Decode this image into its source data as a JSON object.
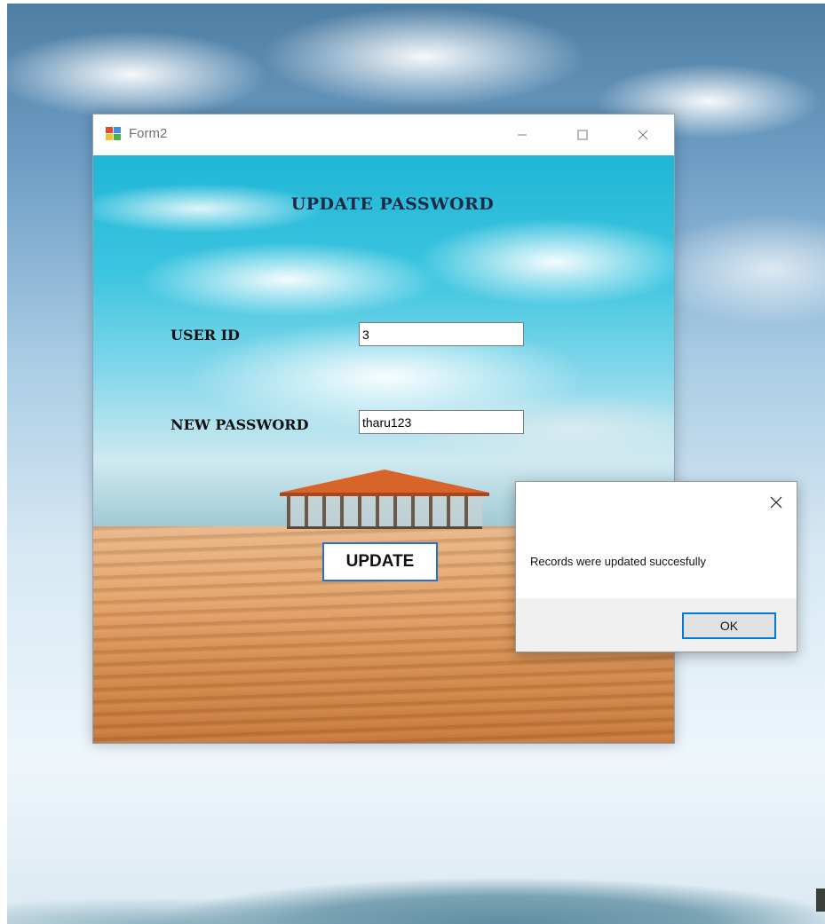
{
  "window": {
    "title": "Form2",
    "controls": {
      "minimize": "minimize-icon",
      "maximize": "maximize-icon",
      "close": "close-icon"
    }
  },
  "form": {
    "heading": "UPDATE PASSWORD",
    "user_id_label": "USER ID",
    "user_id_value": "3",
    "new_password_label": "NEW PASSWORD",
    "new_password_value": "tharu123",
    "update_button": "UPDATE"
  },
  "message_box": {
    "text": "Records were updated succesfully",
    "ok_button": "OK",
    "close_icon": "close-icon"
  },
  "colors": {
    "accent": "#0078d7",
    "update_border": "#2a6fc9"
  }
}
